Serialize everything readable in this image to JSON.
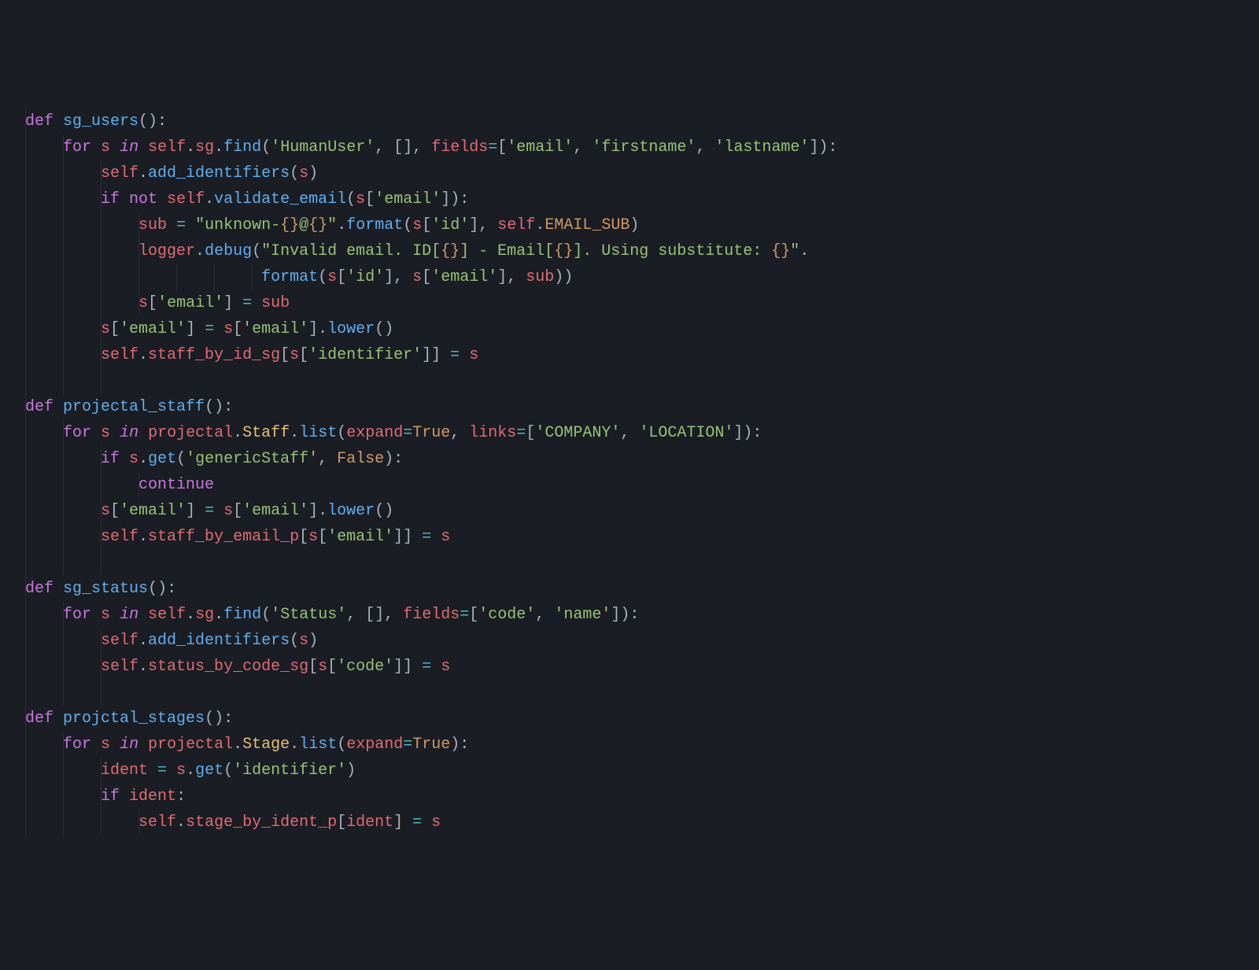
{
  "code": {
    "tokens": [
      [
        [
          "kw",
          "def"
        ],
        [
          "nm",
          " "
        ],
        [
          "fn",
          "sg_users"
        ],
        [
          "pu",
          "():"
        ]
      ],
      [
        [
          "nm",
          "    "
        ],
        [
          "kw",
          "for"
        ],
        [
          "nm",
          " "
        ],
        [
          "va",
          "s"
        ],
        [
          "nm",
          " "
        ],
        [
          "kw-it",
          "in"
        ],
        [
          "nm",
          " "
        ],
        [
          "va",
          "self"
        ],
        [
          "pu",
          "."
        ],
        [
          "va",
          "sg"
        ],
        [
          "pu",
          "."
        ],
        [
          "fn",
          "find"
        ],
        [
          "pu",
          "("
        ],
        [
          "st",
          "'HumanUser'"
        ],
        [
          "pu",
          ", [], "
        ],
        [
          "va",
          "fields"
        ],
        [
          "op",
          "="
        ],
        [
          "pu",
          "["
        ],
        [
          "st",
          "'email'"
        ],
        [
          "pu",
          ", "
        ],
        [
          "st",
          "'firstname'"
        ],
        [
          "pu",
          ", "
        ],
        [
          "st",
          "'lastname'"
        ],
        [
          "pu",
          "]):"
        ]
      ],
      [
        [
          "nm",
          "        "
        ],
        [
          "va",
          "self"
        ],
        [
          "pu",
          "."
        ],
        [
          "fn",
          "add_identifiers"
        ],
        [
          "pu",
          "("
        ],
        [
          "va",
          "s"
        ],
        [
          "pu",
          ")"
        ]
      ],
      [
        [
          "nm",
          "        "
        ],
        [
          "kw",
          "if"
        ],
        [
          "nm",
          " "
        ],
        [
          "kw",
          "not"
        ],
        [
          "nm",
          " "
        ],
        [
          "va",
          "self"
        ],
        [
          "pu",
          "."
        ],
        [
          "fn",
          "validate_email"
        ],
        [
          "pu",
          "("
        ],
        [
          "va",
          "s"
        ],
        [
          "pu",
          "["
        ],
        [
          "st",
          "'email'"
        ],
        [
          "pu",
          "]):"
        ]
      ],
      [
        [
          "nm",
          "            "
        ],
        [
          "va",
          "sub"
        ],
        [
          "nm",
          " "
        ],
        [
          "op",
          "="
        ],
        [
          "nm",
          " "
        ],
        [
          "st",
          "\"unknown-"
        ],
        [
          "co",
          "{}"
        ],
        [
          "st",
          "@"
        ],
        [
          "co",
          "{}"
        ],
        [
          "st",
          "\""
        ],
        [
          "pu",
          "."
        ],
        [
          "fn",
          "format"
        ],
        [
          "pu",
          "("
        ],
        [
          "va",
          "s"
        ],
        [
          "pu",
          "["
        ],
        [
          "st",
          "'id'"
        ],
        [
          "pu",
          "], "
        ],
        [
          "va",
          "self"
        ],
        [
          "pu",
          "."
        ],
        [
          "co",
          "EMAIL_SUB"
        ],
        [
          "pu",
          ")"
        ]
      ],
      [
        [
          "nm",
          "            "
        ],
        [
          "va",
          "logger"
        ],
        [
          "pu",
          "."
        ],
        [
          "fn",
          "debug"
        ],
        [
          "pu",
          "("
        ],
        [
          "st",
          "\"Invalid email. ID["
        ],
        [
          "co",
          "{}"
        ],
        [
          "st",
          "] - Email["
        ],
        [
          "co",
          "{}"
        ],
        [
          "st",
          "]. Using substitute: "
        ],
        [
          "co",
          "{}"
        ],
        [
          "st",
          "\""
        ],
        [
          "pu",
          "."
        ]
      ],
      [
        [
          "nm",
          "                         "
        ],
        [
          "fn",
          "format"
        ],
        [
          "pu",
          "("
        ],
        [
          "va",
          "s"
        ],
        [
          "pu",
          "["
        ],
        [
          "st",
          "'id'"
        ],
        [
          "pu",
          "], "
        ],
        [
          "va",
          "s"
        ],
        [
          "pu",
          "["
        ],
        [
          "st",
          "'email'"
        ],
        [
          "pu",
          "], "
        ],
        [
          "va",
          "sub"
        ],
        [
          "pu",
          "))"
        ]
      ],
      [
        [
          "nm",
          "            "
        ],
        [
          "va",
          "s"
        ],
        [
          "pu",
          "["
        ],
        [
          "st",
          "'email'"
        ],
        [
          "pu",
          "] "
        ],
        [
          "op",
          "="
        ],
        [
          "nm",
          " "
        ],
        [
          "va",
          "sub"
        ]
      ],
      [
        [
          "nm",
          "        "
        ],
        [
          "va",
          "s"
        ],
        [
          "pu",
          "["
        ],
        [
          "st",
          "'email'"
        ],
        [
          "pu",
          "] "
        ],
        [
          "op",
          "="
        ],
        [
          "nm",
          " "
        ],
        [
          "va",
          "s"
        ],
        [
          "pu",
          "["
        ],
        [
          "st",
          "'email'"
        ],
        [
          "pu",
          "]."
        ],
        [
          "fn",
          "lower"
        ],
        [
          "pu",
          "()"
        ]
      ],
      [
        [
          "nm",
          "        "
        ],
        [
          "va",
          "self"
        ],
        [
          "pu",
          "."
        ],
        [
          "va",
          "staff_by_id_sg"
        ],
        [
          "pu",
          "["
        ],
        [
          "va",
          "s"
        ],
        [
          "pu",
          "["
        ],
        [
          "st",
          "'identifier'"
        ],
        [
          "pu",
          "]] "
        ],
        [
          "op",
          "="
        ],
        [
          "nm",
          " "
        ],
        [
          "va",
          "s"
        ]
      ],
      [],
      [
        [
          "kw",
          "def"
        ],
        [
          "nm",
          " "
        ],
        [
          "fn",
          "projectal_staff"
        ],
        [
          "pu",
          "():"
        ]
      ],
      [
        [
          "nm",
          "    "
        ],
        [
          "kw",
          "for"
        ],
        [
          "nm",
          " "
        ],
        [
          "va",
          "s"
        ],
        [
          "nm",
          " "
        ],
        [
          "kw-it",
          "in"
        ],
        [
          "nm",
          " "
        ],
        [
          "va",
          "projectal"
        ],
        [
          "pu",
          "."
        ],
        [
          "se",
          "Staff"
        ],
        [
          "pu",
          "."
        ],
        [
          "fn",
          "list"
        ],
        [
          "pu",
          "("
        ],
        [
          "va",
          "expand"
        ],
        [
          "op",
          "="
        ],
        [
          "bo",
          "True"
        ],
        [
          "pu",
          ", "
        ],
        [
          "va",
          "links"
        ],
        [
          "op",
          "="
        ],
        [
          "pu",
          "["
        ],
        [
          "st",
          "'COMPANY'"
        ],
        [
          "pu",
          ", "
        ],
        [
          "st",
          "'LOCATION'"
        ],
        [
          "pu",
          "]):"
        ]
      ],
      [
        [
          "nm",
          "        "
        ],
        [
          "kw",
          "if"
        ],
        [
          "nm",
          " "
        ],
        [
          "va",
          "s"
        ],
        [
          "pu",
          "."
        ],
        [
          "fn",
          "get"
        ],
        [
          "pu",
          "("
        ],
        [
          "st",
          "'genericStaff'"
        ],
        [
          "pu",
          ", "
        ],
        [
          "bo",
          "False"
        ],
        [
          "pu",
          "):"
        ]
      ],
      [
        [
          "nm",
          "            "
        ],
        [
          "kw",
          "continue"
        ]
      ],
      [
        [
          "nm",
          "        "
        ],
        [
          "va",
          "s"
        ],
        [
          "pu",
          "["
        ],
        [
          "st",
          "'email'"
        ],
        [
          "pu",
          "] "
        ],
        [
          "op",
          "="
        ],
        [
          "nm",
          " "
        ],
        [
          "va",
          "s"
        ],
        [
          "pu",
          "["
        ],
        [
          "st",
          "'email'"
        ],
        [
          "pu",
          "]."
        ],
        [
          "fn",
          "lower"
        ],
        [
          "pu",
          "()"
        ]
      ],
      [
        [
          "nm",
          "        "
        ],
        [
          "va",
          "self"
        ],
        [
          "pu",
          "."
        ],
        [
          "va",
          "staff_by_email_p"
        ],
        [
          "pu",
          "["
        ],
        [
          "va",
          "s"
        ],
        [
          "pu",
          "["
        ],
        [
          "st",
          "'email'"
        ],
        [
          "pu",
          "]] "
        ],
        [
          "op",
          "="
        ],
        [
          "nm",
          " "
        ],
        [
          "va",
          "s"
        ]
      ],
      [],
      [
        [
          "kw",
          "def"
        ],
        [
          "nm",
          " "
        ],
        [
          "fn",
          "sg_status"
        ],
        [
          "pu",
          "():"
        ]
      ],
      [
        [
          "nm",
          "    "
        ],
        [
          "kw",
          "for"
        ],
        [
          "nm",
          " "
        ],
        [
          "va",
          "s"
        ],
        [
          "nm",
          " "
        ],
        [
          "kw-it",
          "in"
        ],
        [
          "nm",
          " "
        ],
        [
          "va",
          "self"
        ],
        [
          "pu",
          "."
        ],
        [
          "va",
          "sg"
        ],
        [
          "pu",
          "."
        ],
        [
          "fn",
          "find"
        ],
        [
          "pu",
          "("
        ],
        [
          "st",
          "'Status'"
        ],
        [
          "pu",
          ", [], "
        ],
        [
          "va",
          "fields"
        ],
        [
          "op",
          "="
        ],
        [
          "pu",
          "["
        ],
        [
          "st",
          "'code'"
        ],
        [
          "pu",
          ", "
        ],
        [
          "st",
          "'name'"
        ],
        [
          "pu",
          "]):"
        ]
      ],
      [
        [
          "nm",
          "        "
        ],
        [
          "va",
          "self"
        ],
        [
          "pu",
          "."
        ],
        [
          "fn",
          "add_identifiers"
        ],
        [
          "pu",
          "("
        ],
        [
          "va",
          "s"
        ],
        [
          "pu",
          ")"
        ]
      ],
      [
        [
          "nm",
          "        "
        ],
        [
          "va",
          "self"
        ],
        [
          "pu",
          "."
        ],
        [
          "va",
          "status_by_code_sg"
        ],
        [
          "pu",
          "["
        ],
        [
          "va",
          "s"
        ],
        [
          "pu",
          "["
        ],
        [
          "st",
          "'code'"
        ],
        [
          "pu",
          "]] "
        ],
        [
          "op",
          "="
        ],
        [
          "nm",
          " "
        ],
        [
          "va",
          "s"
        ]
      ],
      [],
      [
        [
          "kw",
          "def"
        ],
        [
          "nm",
          " "
        ],
        [
          "fn",
          "projctal_stages"
        ],
        [
          "pu",
          "():"
        ]
      ],
      [
        [
          "nm",
          "    "
        ],
        [
          "kw",
          "for"
        ],
        [
          "nm",
          " "
        ],
        [
          "va",
          "s"
        ],
        [
          "nm",
          " "
        ],
        [
          "kw-it",
          "in"
        ],
        [
          "nm",
          " "
        ],
        [
          "va",
          "projectal"
        ],
        [
          "pu",
          "."
        ],
        [
          "se",
          "Stage"
        ],
        [
          "pu",
          "."
        ],
        [
          "fn",
          "list"
        ],
        [
          "pu",
          "("
        ],
        [
          "va",
          "expand"
        ],
        [
          "op",
          "="
        ],
        [
          "bo",
          "True"
        ],
        [
          "pu",
          "):"
        ]
      ],
      [
        [
          "nm",
          "        "
        ],
        [
          "va",
          "ident"
        ],
        [
          "nm",
          " "
        ],
        [
          "op",
          "="
        ],
        [
          "nm",
          " "
        ],
        [
          "va",
          "s"
        ],
        [
          "pu",
          "."
        ],
        [
          "fn",
          "get"
        ],
        [
          "pu",
          "("
        ],
        [
          "st",
          "'identifier'"
        ],
        [
          "pu",
          ")"
        ]
      ],
      [
        [
          "nm",
          "        "
        ],
        [
          "kw",
          "if"
        ],
        [
          "nm",
          " "
        ],
        [
          "va",
          "ident"
        ],
        [
          "pu",
          ":"
        ]
      ],
      [
        [
          "nm",
          "            "
        ],
        [
          "va",
          "self"
        ],
        [
          "pu",
          "."
        ],
        [
          "va",
          "stage_by_ident_p"
        ],
        [
          "pu",
          "["
        ],
        [
          "va",
          "ident"
        ],
        [
          "pu",
          "] "
        ],
        [
          "op",
          "="
        ],
        [
          "nm",
          " "
        ],
        [
          "va",
          "s"
        ]
      ]
    ]
  }
}
